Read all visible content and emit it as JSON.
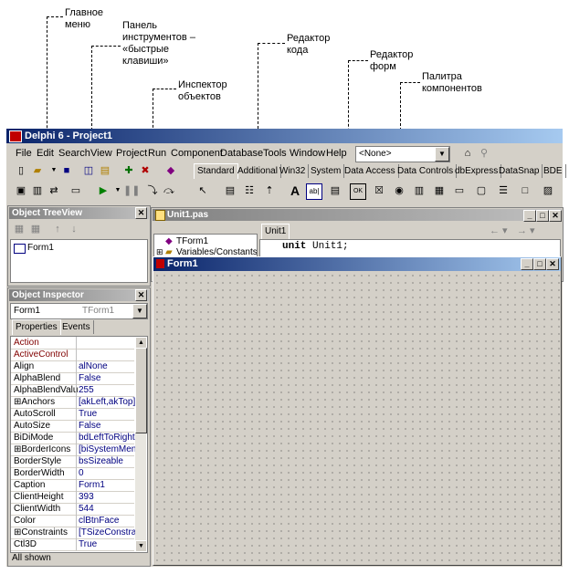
{
  "annotations": {
    "main_menu": "Главное\nменю",
    "toolbar": "Панель\nинструментов –\n«быстрые\nклавиши»",
    "inspector": "Инспектор\nобъектов",
    "code_editor": "Редактор\nкода",
    "form_editor": "Редактор\nформ",
    "palette": "Палитра\nкомпонентов"
  },
  "window": {
    "title": "Delphi 6 - Project1"
  },
  "menu": [
    "File",
    "Edit",
    "Search",
    "View",
    "Project",
    "Run",
    "Component",
    "Database",
    "Tools",
    "Window",
    "Help"
  ],
  "config_combo": {
    "value": "<None>"
  },
  "palette_tabs": [
    "Standard",
    "Additional",
    "Win32",
    "System",
    "Data Access",
    "Data Controls",
    "dbExpress",
    "DataSnap",
    "BDE"
  ],
  "tree_view": {
    "title": "Object TreeView",
    "item": "Form1"
  },
  "inspector": {
    "title": "Object Inspector",
    "object_name": "Form1",
    "object_type": "TForm1",
    "tabs": [
      "Properties",
      "Events"
    ],
    "status": "All shown",
    "properties": [
      {
        "name": "Action",
        "value": ""
      },
      {
        "name": "ActiveControl",
        "value": ""
      },
      {
        "name": "Align",
        "value": "alNone"
      },
      {
        "name": "AlphaBlend",
        "value": "False"
      },
      {
        "name": "AlphaBlendValu",
        "value": "255"
      },
      {
        "name": "⊞Anchors",
        "value": "[akLeft,akTop]"
      },
      {
        "name": "AutoScroll",
        "value": "True"
      },
      {
        "name": "AutoSize",
        "value": "False"
      },
      {
        "name": "BiDiMode",
        "value": "bdLeftToRight"
      },
      {
        "name": "⊞BorderIcons",
        "value": "[biSystemMenu,"
      },
      {
        "name": "BorderStyle",
        "value": "bsSizeable"
      },
      {
        "name": "BorderWidth",
        "value": "0"
      },
      {
        "name": "Caption",
        "value": "Form1"
      },
      {
        "name": "ClientHeight",
        "value": "393"
      },
      {
        "name": "ClientWidth",
        "value": "544"
      },
      {
        "name": "Color",
        "value": "clBtnFace"
      },
      {
        "name": "⊞Constraints",
        "value": "[TSizeConstraint"
      },
      {
        "name": "Ctl3D",
        "value": "True"
      }
    ]
  },
  "code_editor": {
    "title": "Unit1.pas",
    "tab": "Unit1",
    "explorer_items": [
      "TForm1",
      "Variables/Constants"
    ],
    "code_keyword": "unit",
    "code_rest": " Unit1;"
  },
  "form": {
    "title": "Form1"
  },
  "colors": {
    "title_active": "#0a246a",
    "title_gradient_end": "#a6caf0",
    "face": "#d4d0c8",
    "property_red": "#800000"
  }
}
